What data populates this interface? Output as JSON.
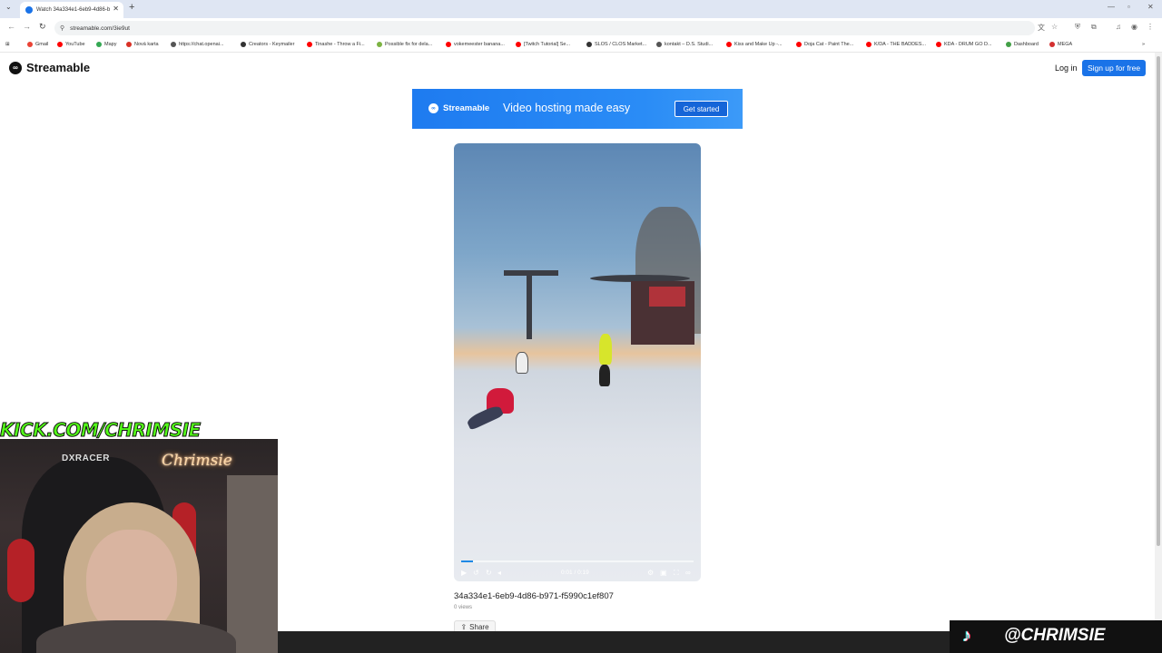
{
  "browser": {
    "tab_title": "Watch 34a334e1-6eb9-4d86-b",
    "new_tab": "+",
    "url": "streamable.com/3ie9ut",
    "bookmarks": [
      {
        "label": "Gmail",
        "color": "#ea4335"
      },
      {
        "label": "YouTube",
        "color": "#ff0000"
      },
      {
        "label": "Mapy",
        "color": "#34a853"
      },
      {
        "label": "Nová karta",
        "color": "#d93025"
      },
      {
        "label": "https://chat.openai...",
        "color": "#555555"
      },
      {
        "label": "Creators - Keymailer",
        "color": "#333333"
      },
      {
        "label": "Tinashe - Throw a Fi...",
        "color": "#ff0000"
      },
      {
        "label": "Possible fix for dela...",
        "color": "#7cb342"
      },
      {
        "label": "vokemeester banana...",
        "color": "#ff0000"
      },
      {
        "label": "[Twitch Tutorial] Se...",
        "color": "#ff0000"
      },
      {
        "label": "SLOS / CLOS Market...",
        "color": "#333333"
      },
      {
        "label": "kontakt – D.S. Studi...",
        "color": "#555555"
      },
      {
        "label": "Kiss and Make Up -...",
        "color": "#ff0000"
      },
      {
        "label": "Doja Cat - Paint The...",
        "color": "#ff0000"
      },
      {
        "label": "K/DA - THE BADDES...",
        "color": "#ff0000"
      },
      {
        "label": "KDA - DRUM GO D...",
        "color": "#ff0000"
      },
      {
        "label": "Dashboard",
        "color": "#43a047"
      },
      {
        "label": "MEGA",
        "color": "#d32f2f"
      }
    ]
  },
  "site": {
    "logo": "Streamable",
    "login": "Log in",
    "signup": "Sign up for free"
  },
  "banner": {
    "logo": "Streamable",
    "tagline": "Video hosting made easy",
    "cta": "Get started"
  },
  "video": {
    "time": "0:01 / 0:19",
    "progress": 0.05,
    "title": "34a334e1-6eb9-4d86-b971-f5990c1ef807",
    "views": "0 views",
    "share": "Share"
  },
  "overlay": {
    "kick": "KICK.COM/CHRIMSIE",
    "neon": "Chrimsie",
    "chair_brand": "DXRACER",
    "tiktok": "@CHRIMSIE"
  }
}
